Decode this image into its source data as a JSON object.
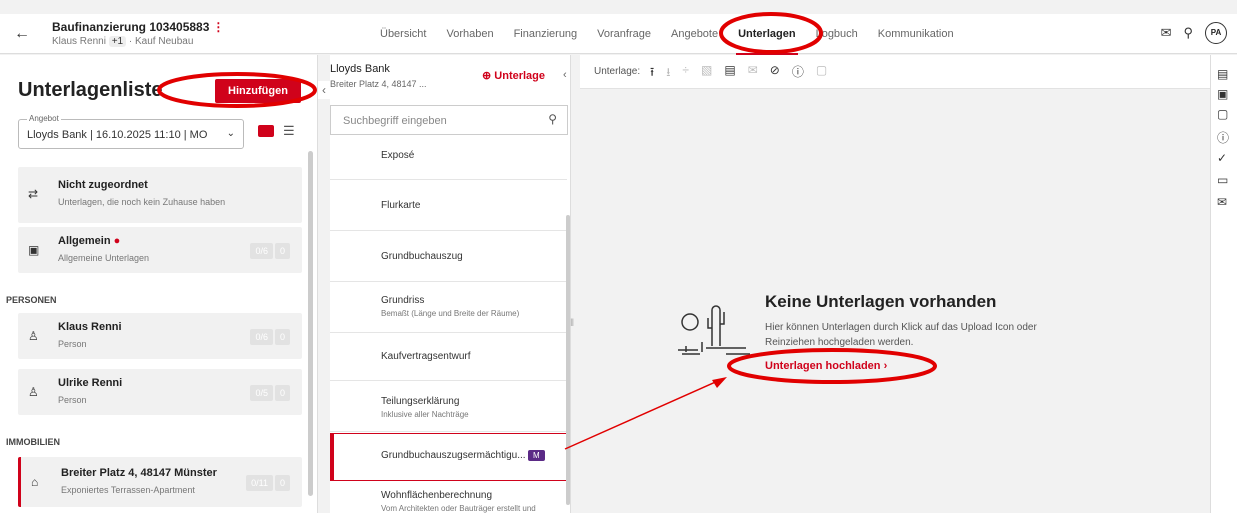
{
  "header": {
    "title": "Baufinanzierung 103405883",
    "kebab": "⋮",
    "sub_name": "Klaus Renni",
    "sub_plus": "+1",
    "sub_type": "· Kauf Neubau",
    "nav": [
      "Übersicht",
      "Vorhaben",
      "Finanzierung",
      "Voranfrage",
      "Angebote",
      "Unterlagen",
      "Logbuch",
      "Kommunikation"
    ],
    "active_tab": "Unterlagen",
    "avatar": "PA"
  },
  "left": {
    "title": "Unterlagenliste",
    "add_button": "Hinzufügen",
    "select_label": "Angebot",
    "select_value": "Lloyds Bank | 16.10.2025 11:10 | MO",
    "cards": [
      {
        "title": "Nicht zugeordnet",
        "subtitle": "Unterlagen, die noch kein Zuhause haben"
      },
      {
        "title": "Allgemein",
        "subtitle": "Allgemeine Unterlagen",
        "count_a": "0/6",
        "count_b": "0"
      }
    ],
    "section_personen": "PERSONEN",
    "persons": [
      {
        "title": "Klaus Renni",
        "subtitle": "Person",
        "count_a": "0/6",
        "count_b": "0"
      },
      {
        "title": "Ulrike Renni",
        "subtitle": "Person",
        "count_a": "0/5",
        "count_b": "0"
      }
    ],
    "section_immobilien": "IMMOBILIEN",
    "property": {
      "title": "Breiter Platz 4, 48147 Münster",
      "subtitle": "Exponiertes Terrassen-Apartment",
      "count_a": "0/11",
      "count_b": "0"
    }
  },
  "middle": {
    "bank": "Lloyds Bank",
    "address": "Breiter Platz 4, 48147 ...",
    "add_label": "Unterlage",
    "search_placeholder": "Suchbegriff eingeben",
    "docs": [
      {
        "title": "Exposé",
        "subtitle": ""
      },
      {
        "title": "Flurkarte",
        "subtitle": ""
      },
      {
        "title": "Grundbuchauszug",
        "subtitle": ""
      },
      {
        "title": "Grundriss",
        "subtitle": "Bemaßt (Länge und Breite der Räume)"
      },
      {
        "title": "Kaufvertragsentwurf",
        "subtitle": ""
      },
      {
        "title": "Teilungserklärung",
        "subtitle": "Inklusive aller Nachträge"
      },
      {
        "title": "Grundbuchauszugsermächtigu...",
        "subtitle": "",
        "badge": "M"
      },
      {
        "title": "Wohnflächenberechnung",
        "subtitle": "Vom Architekten oder Bauträger erstellt und"
      }
    ]
  },
  "right": {
    "toolbar_label": "Unterlage:",
    "empty_title": "Keine Unterlagen vorhanden",
    "empty_text": "Hier können Unterlagen durch Klick auf das Upload Icon oder Reinziehen hochgeladen werden.",
    "upload_link": "Unterlagen hochladen"
  },
  "colors": {
    "accent": "#d0021b",
    "badge": "#5b2a86"
  }
}
